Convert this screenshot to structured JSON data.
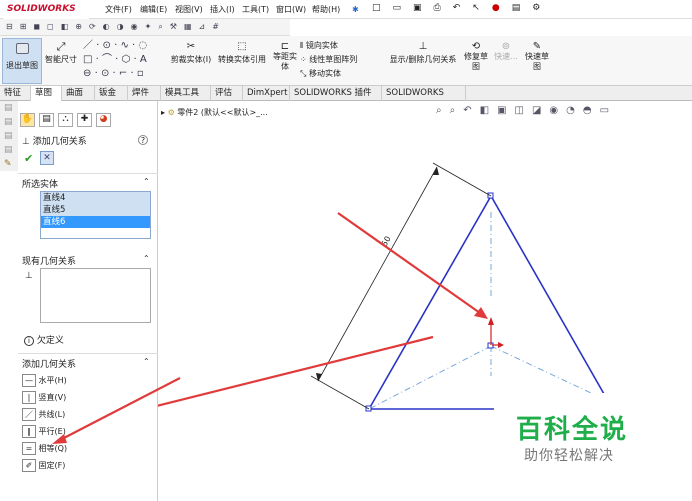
{
  "app": {
    "logo": "SOLIDWORKS"
  },
  "menu": [
    "文件(F)",
    "编辑(E)",
    "视图(V)",
    "插入(I)",
    "工具(T)",
    "窗口(W)",
    "帮助(H)"
  ],
  "ribbon": {
    "exit_sketch": "退出草图",
    "smart_dim": "智能尺寸",
    "trim": "剪裁实体(I)",
    "convert": "转换实体引用",
    "offset_a": "等距实",
    "offset_b": "体",
    "mirror": "镜向实体",
    "pattern": "线性草图阵列",
    "move": "移动实体",
    "display_rel": "显示/删除几何关系",
    "repair_a": "修复草",
    "repair_b": "图",
    "quick_snap": "快速...",
    "rapid_a": "快速草",
    "rapid_b": "图"
  },
  "tabs": [
    "特征",
    "草图",
    "曲面",
    "钣金",
    "焊件",
    "模具工具",
    "评估",
    "DimXpert",
    "SOLIDWORKS 插件",
    "SOLIDWORKS MBD"
  ],
  "active_tab": "草图",
  "panel": {
    "title": "添加几何关系",
    "selected_title": "所选实体",
    "selected_items": [
      "直线4",
      "直线5",
      "直线6"
    ],
    "existing_title": "现有几何关系",
    "status": "欠定义",
    "add_title": "添加几何关系",
    "relations": [
      "水平(H)",
      "竖直(V)",
      "共线(L)",
      "平行(E)",
      "相等(Q)",
      "固定(F)"
    ]
  },
  "tree": {
    "label": "零件2 (默认<<默认>_..."
  },
  "dimension": {
    "value": "50"
  },
  "watermark": {
    "title": "百科全说",
    "subtitle": "助你轻松解决"
  },
  "colors": {
    "sketch_line": "#2a33c8",
    "arrow": "#e03a3a",
    "dim_line": "#222222",
    "logo": "#c8102e"
  }
}
